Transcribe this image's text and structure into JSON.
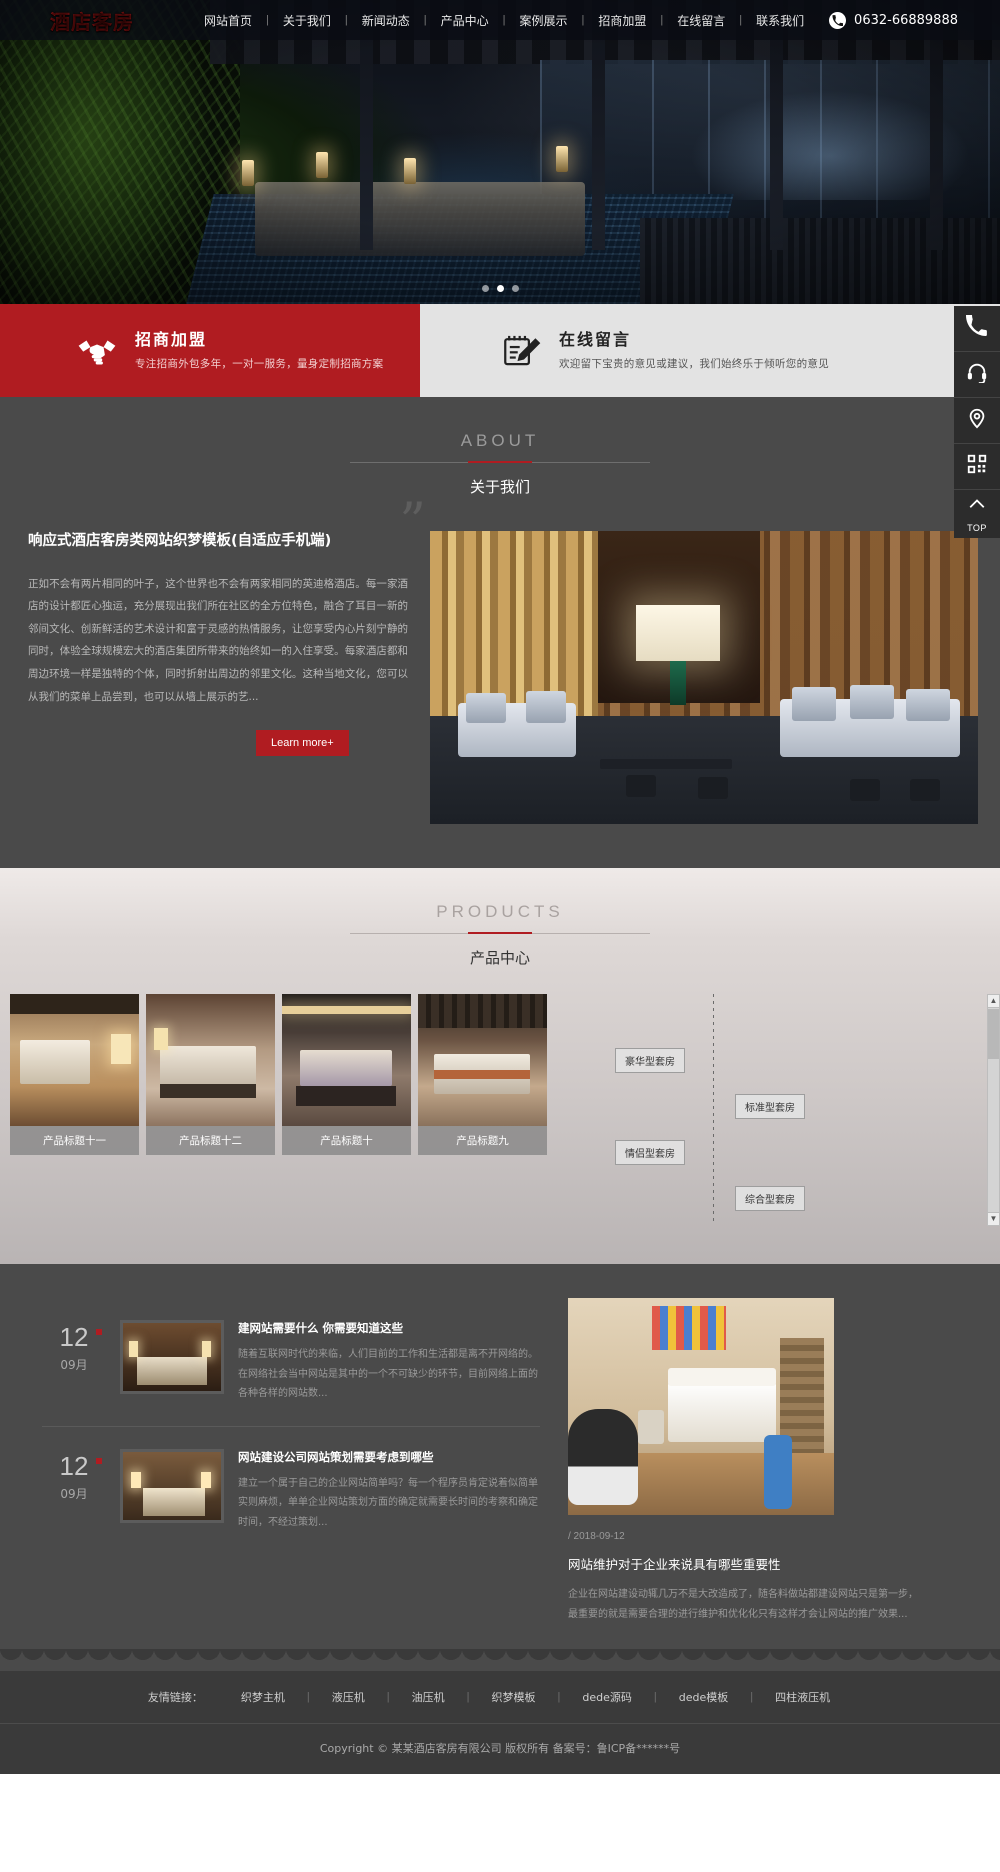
{
  "header": {
    "logo_text": "酒店客房",
    "nav": [
      {
        "label": "网站首页"
      },
      {
        "label": "关于我们"
      },
      {
        "label": "新闻动态"
      },
      {
        "label": "产品中心"
      },
      {
        "label": "案例展示"
      },
      {
        "label": "招商加盟"
      },
      {
        "label": "在线留言"
      },
      {
        "label": "联系我们"
      }
    ],
    "phone_icon": "telephone-icon",
    "phone": "0632-66889888"
  },
  "hero": {
    "dots": [
      "slide-1",
      "slide-2",
      "slide-3"
    ],
    "active_index": 1
  },
  "promo": {
    "left": {
      "icon": "handshake-icon",
      "title": "招商加盟",
      "subtitle": "专注招商外包多年，一对一服务，量身定制招商方案"
    },
    "right": {
      "icon": "note-pencil-icon",
      "title": "在线留言",
      "subtitle": "欢迎留下宝贵的意见或建议，我们始终乐于倾听您的意见"
    }
  },
  "about": {
    "en": "ABOUT",
    "cn": "关于我们",
    "quote": "”",
    "title": "响应式酒店客房类网站织梦模板(自适应手机端)",
    "body": "正如不会有两片相同的叶子，这个世界也不会有两家相同的英迪格酒店。每一家酒店的设计都匠心独运，充分展现出我们所在社区的全方位特色，融合了耳目一新的邻间文化、创新鲜活的艺术设计和富于灵感的热情服务，让您享受内心片刻宁静的同时，体验全球规模宏大的酒店集团所带来的始终如一的入住享受。每家酒店都和周边环境一样是独特的个体，同时折射出周边的邻里文化。这种当地文化，您可以从我们的菜单上品尝到，也可以从墙上展示的艺...",
    "button": "Learn more+"
  },
  "products": {
    "en": "PRODUCTS",
    "cn": "产品中心",
    "items": [
      {
        "caption": "产品标题十一"
      },
      {
        "caption": "产品标题十二"
      },
      {
        "caption": "产品标题十"
      },
      {
        "caption": "产品标题九"
      }
    ],
    "tags": [
      {
        "label": "豪华型套房"
      },
      {
        "label": "标准型套房"
      },
      {
        "label": "情侣型套房"
      },
      {
        "label": "综合型套房"
      }
    ],
    "scroll_up": "▲",
    "scroll_down": "▼"
  },
  "news": {
    "items": [
      {
        "day": "12",
        "month": "09月",
        "title": "建网站需要什么 你需要知道这些",
        "desc": "随着互联网时代的来临，人们目前的工作和生活都是离不开网络的。在网络社会当中网站是其中的一个不可缺少的环节，目前网络上面的各种各样的网站数..."
      },
      {
        "day": "12",
        "month": "09月",
        "title": "网站建设公司网站策划需要考虑到哪些",
        "desc": "建立一个属于自己的企业网站简单吗？每一个程序员肯定说着似简单实则麻烦，单单企业网站策划方面的确定就需要长时间的考察和确定时间，不经过策划..."
      }
    ],
    "feature": {
      "date": "/ 2018-09-12",
      "title": "网站维护对于企业来说具有哪些重要性",
      "desc": "企业在网站建设动辄几万不是大改造成了，随各料做站都建设网站只是第一步，最重要的就是需要合理的进行维护和优化化只有这样才会让网站的推广效果..."
    }
  },
  "footer": {
    "links_label": "友情链接：",
    "links": [
      {
        "label": "织梦主机"
      },
      {
        "label": "液压机"
      },
      {
        "label": "油压机"
      },
      {
        "label": "织梦模板"
      },
      {
        "label": "dede源码"
      },
      {
        "label": "dede模板"
      },
      {
        "label": "四柱液压机"
      }
    ],
    "copyright": "Copyright © 某某酒店客房有限公司 版权所有 备案号：鲁ICP备******号"
  },
  "sidebar": {
    "items": [
      {
        "icon": "phone-icon",
        "name": "phone"
      },
      {
        "icon": "headset-icon",
        "name": "service"
      },
      {
        "icon": "location-icon",
        "name": "map"
      },
      {
        "icon": "qrcode-icon",
        "name": "qrcode"
      },
      {
        "icon": "arrow-up-icon",
        "name": "top",
        "label": "TOP"
      }
    ]
  },
  "colors": {
    "brand_red": "#b01c21",
    "dark_gray": "#4a4a4a",
    "footer_gray": "#3a3a3a",
    "header_dark": "#0a0c14"
  }
}
